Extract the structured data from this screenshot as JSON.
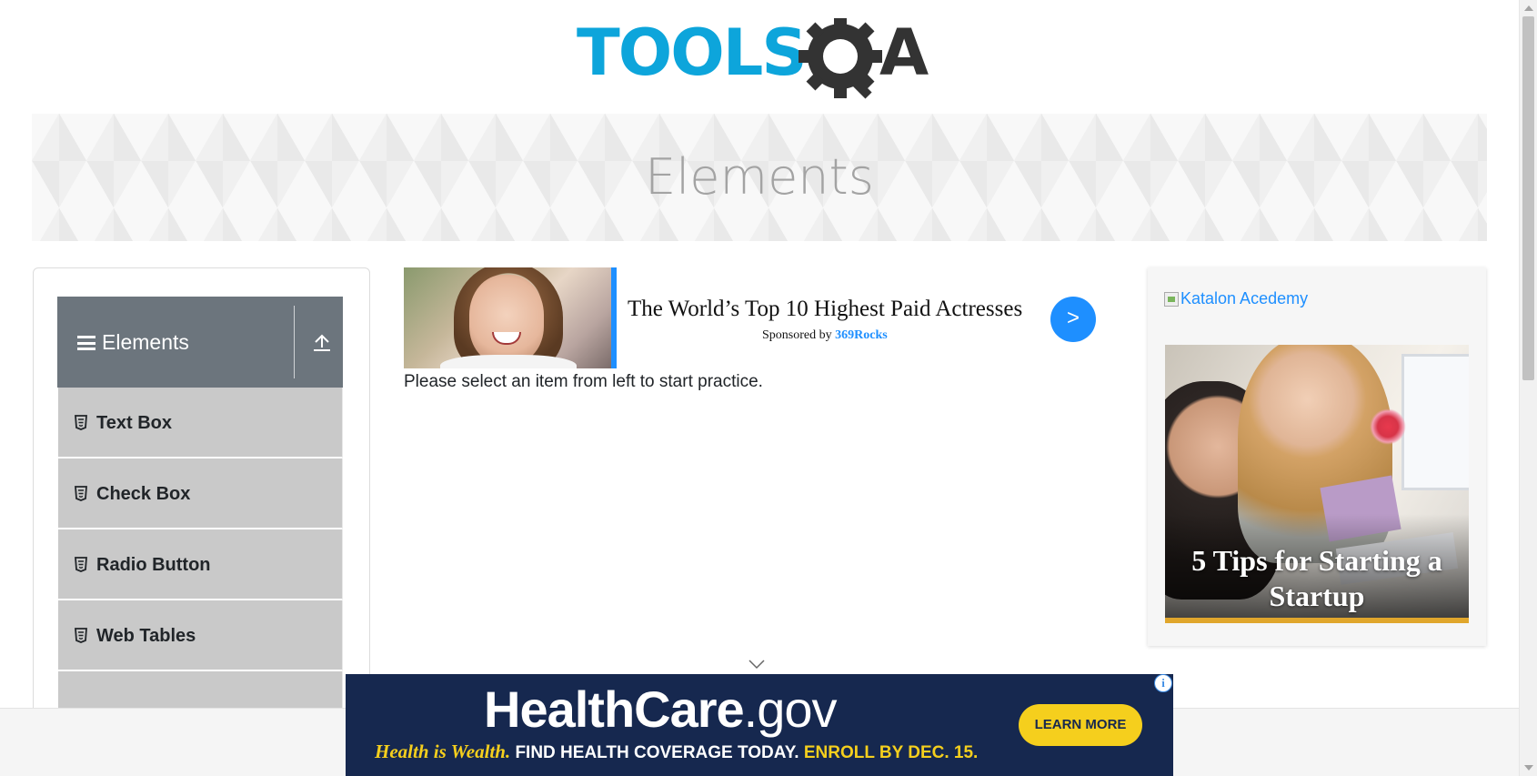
{
  "header": {
    "logo_text_left": "TOOLS",
    "logo_text_right": "A",
    "logo_color": "#0da5db",
    "logo_dark": "#333333"
  },
  "banner": {
    "title": "Elements"
  },
  "sidebar": {
    "group_title": "Elements",
    "group_header_color": "#6c757d",
    "items": [
      {
        "label": "Text Box",
        "icon": "html5-icon"
      },
      {
        "label": "Check Box",
        "icon": "html5-icon"
      },
      {
        "label": "Radio Button",
        "icon": "html5-icon"
      },
      {
        "label": "Web Tables",
        "icon": "html5-icon"
      }
    ]
  },
  "center_ad": {
    "headline": "The World’s Top 10 Highest Paid Actresses",
    "sponsor_prefix": "Sponsored by",
    "sponsor_name": "369Rocks",
    "go_label": ">",
    "accent": "#1e8fff"
  },
  "main": {
    "instruction": "Please select an item from left to start practice."
  },
  "right_ad": {
    "alt_text": "Katalon Acedemy",
    "promo_title": "5 Tips for Starting a Startup"
  },
  "bottom_ad": {
    "logo_main": "HealthCare",
    "logo_suffix": ".gov",
    "tagline_serif": "Health is Wealth.",
    "tagline_mid": "FIND HEALTH COVERAGE TODAY.",
    "tagline_yellow": "ENROLL BY DEC. 15.",
    "cta": "LEARN MORE",
    "info": "i",
    "bg_color": "#16284f",
    "accent": "#f5cf1d"
  }
}
